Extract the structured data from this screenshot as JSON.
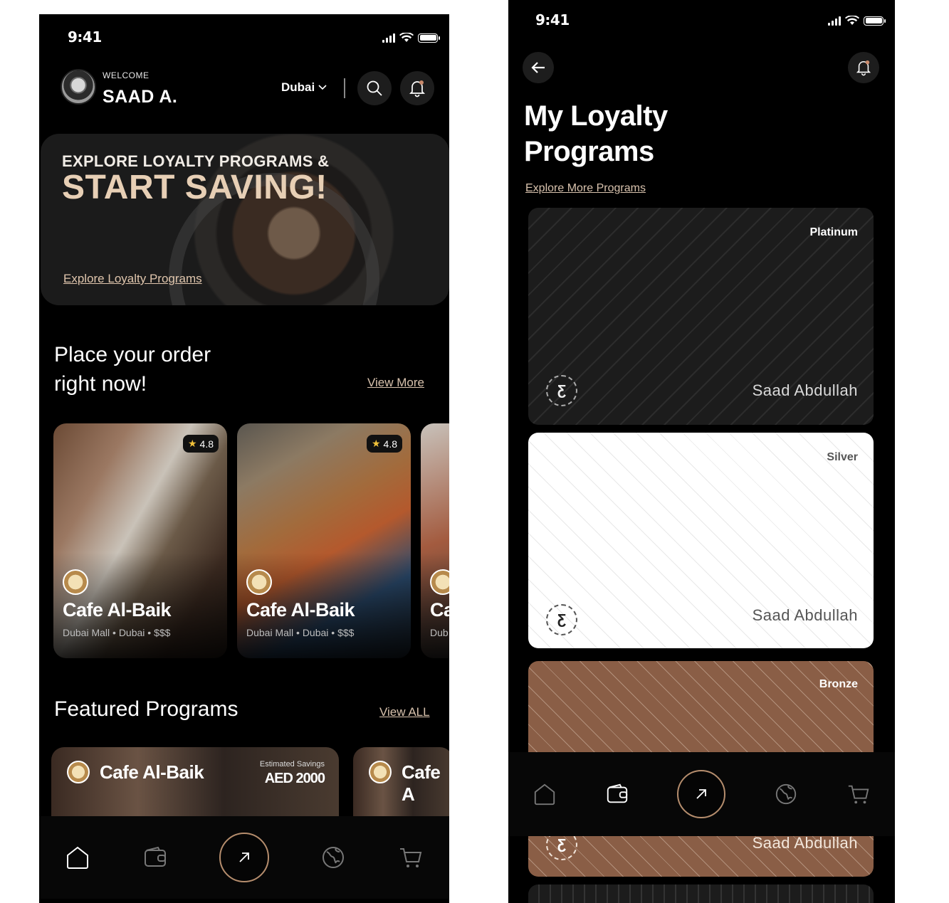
{
  "home": {
    "status_time": "9:41",
    "greeting": "WELCOME",
    "user_name": "SAAD A.",
    "city": "Dubai",
    "hero": {
      "subtitle": "EXPLORE LOYALTY PROGRAMS &",
      "title": "START SAVING!",
      "link": "Explore Loyalty Programs"
    },
    "order_section": {
      "title_line1": "Place your order",
      "title_line2": "right now!",
      "link": "View More"
    },
    "cafes": [
      {
        "name": "Cafe Al-Baik",
        "meta": "Dubai Mall • Dubai • $$$",
        "rating": "4.8"
      },
      {
        "name": "Cafe Al-Baik",
        "meta": "Dubai Mall • Dubai • $$$",
        "rating": "4.8"
      },
      {
        "name": "Ca",
        "meta": "Dub"
      }
    ],
    "featured_section": {
      "title": "Featured Programs",
      "link": "View ALL"
    },
    "featured": [
      {
        "name": "Cafe Al-Baik",
        "savings_label": "Estimated Savings",
        "savings_value": "AED 2000"
      },
      {
        "name": "Cafe A"
      }
    ]
  },
  "loyalty": {
    "status_time": "9:41",
    "title_line1": "My Loyalty",
    "title_line2": "Programs",
    "link": "Explore More Programs",
    "cards": [
      {
        "tier": "Platinum",
        "owner": "Saad Abdullah"
      },
      {
        "tier": "Silver",
        "owner": "Saad Abdullah"
      },
      {
        "tier": "Bronze",
        "owner": "Saad Abdullah"
      }
    ]
  },
  "icons": {
    "tabs": [
      "home-icon",
      "wallet-icon",
      "arrow-up-right-icon",
      "globe-icon",
      "cart-icon"
    ]
  },
  "colors": {
    "background": "#000000",
    "accent": "#b58d6d",
    "hero_title": "#e7cfb5",
    "bronze": "#8a5e46"
  }
}
